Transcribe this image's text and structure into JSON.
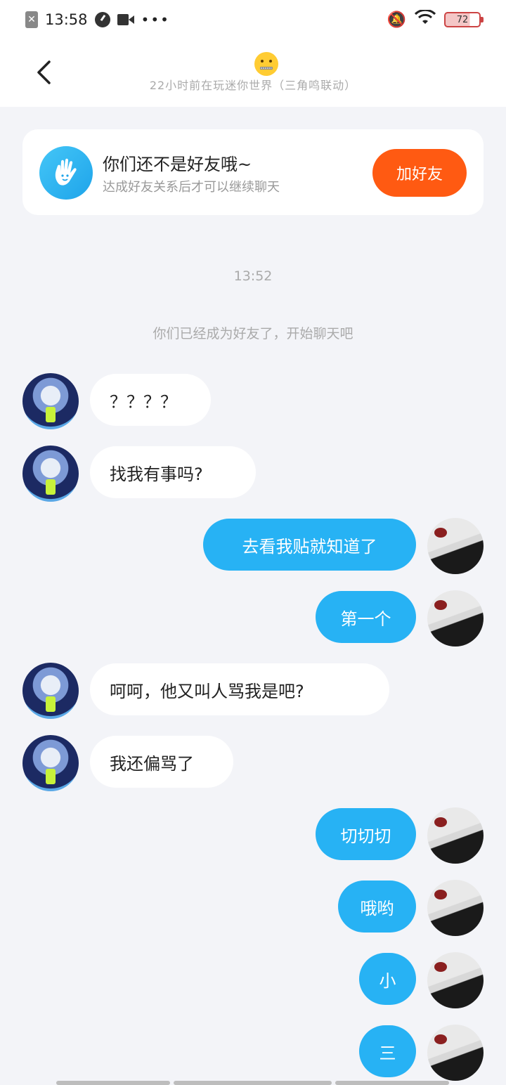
{
  "status_bar": {
    "time": "13:58",
    "battery": "72"
  },
  "header": {
    "subtitle": "22小时前在玩迷你世界（三角鸣联动）"
  },
  "friend_card": {
    "title": "你们还不是好友哦~",
    "subtitle": "达成好友关系后才可以继续聊天",
    "button": "加好友"
  },
  "chat": {
    "time_label": "13:52",
    "system_note": "你们已经成为好友了，开始聊天吧",
    "messages": [
      {
        "side": "left",
        "text": "？？？？"
      },
      {
        "side": "left",
        "text": "找我有事吗?"
      },
      {
        "side": "right",
        "text": "去看我贴就知道了"
      },
      {
        "side": "right",
        "text": "第一个"
      },
      {
        "side": "left",
        "text": "呵呵，他又叫人骂我是吧?"
      },
      {
        "side": "left",
        "text": "我还偏骂了"
      },
      {
        "side": "right",
        "text": "切切切"
      },
      {
        "side": "right",
        "text": "哦哟"
      },
      {
        "side": "right",
        "text": "小"
      },
      {
        "side": "right",
        "text": "三"
      }
    ]
  },
  "colors": {
    "accent_blue": "#27b2f4",
    "add_button": "#ff5a12",
    "background": "#f3f4f8"
  },
  "icons": {
    "back": "chevron-left-icon",
    "wave": "waving-hand-icon",
    "header_avatar": "zipper-mouth-emoji"
  }
}
